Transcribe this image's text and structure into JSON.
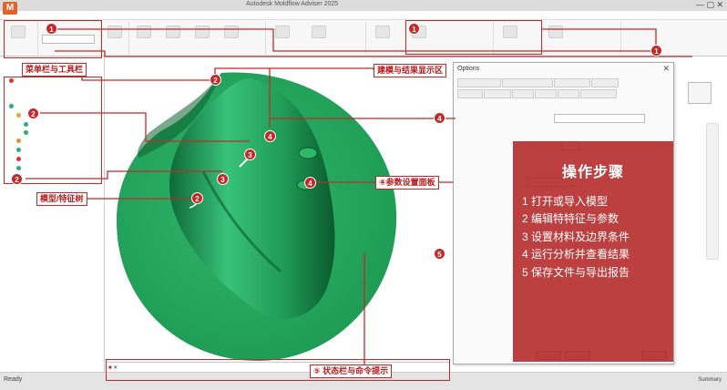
{
  "window": {
    "app_icon": "M",
    "title": "Autodesk Moldflow Adviser 2025"
  },
  "annotations": {
    "menu_toolbar": "菜单栏与工具栏",
    "display_area": "建模与结果显示区",
    "model_tree": "模型/特征树",
    "params_panel": "参数设置面板",
    "status_cmd": "状态栏与命令提示",
    "badge_1": "1",
    "badge_2": "2",
    "badge_3": "3",
    "badge_4": "4",
    "badge_5": "5",
    "num_4_circle": "④",
    "num_5_circle": "⑤"
  },
  "steps": {
    "title": "操作步骤",
    "items": [
      "1  打开或导入模型",
      "2  编辑特特征与参数",
      "3  设置材料及边界条件",
      "4  运行分析并查看结果",
      "5  保存文件与导出报告"
    ]
  },
  "dialog": {
    "title": "Options"
  },
  "statusbar": {
    "status": "Ready",
    "summary": "Summary"
  },
  "colors": {
    "model_green": "#22a05a",
    "annotation_red": "#c62828",
    "steps_bg": "#b22424"
  }
}
